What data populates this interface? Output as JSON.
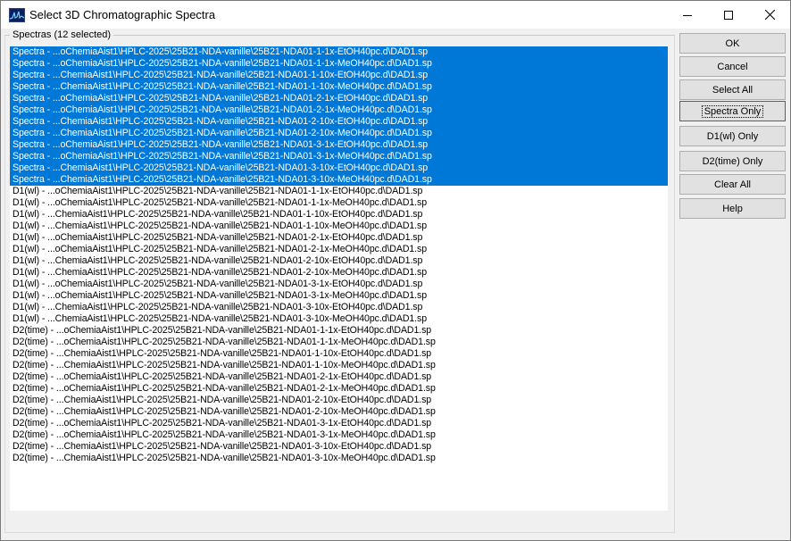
{
  "window": {
    "title": "Select 3D Chromatographic Spectra",
    "icon": "chromatogram-app-icon",
    "controls": [
      "minimize-icon",
      "maximize-icon",
      "close-icon"
    ]
  },
  "group": {
    "label": "Spectras (12 selected)"
  },
  "list": {
    "items": [
      {
        "text": "Spectra - ...oChemiaAist1\\HPLC-2025\\25B21-NDA-vanille\\25B21-NDA01-1-1x-EtOH40pc.d\\DAD1.sp",
        "selected": true
      },
      {
        "text": "Spectra - ...oChemiaAist1\\HPLC-2025\\25B21-NDA-vanille\\25B21-NDA01-1-1x-MeOH40pc.d\\DAD1.sp",
        "selected": true
      },
      {
        "text": "Spectra - ...ChemiaAist1\\HPLC-2025\\25B21-NDA-vanille\\25B21-NDA01-1-10x-EtOH40pc.d\\DAD1.sp",
        "selected": true
      },
      {
        "text": "Spectra - ...ChemiaAist1\\HPLC-2025\\25B21-NDA-vanille\\25B21-NDA01-1-10x-MeOH40pc.d\\DAD1.sp",
        "selected": true
      },
      {
        "text": "Spectra - ...oChemiaAist1\\HPLC-2025\\25B21-NDA-vanille\\25B21-NDA01-2-1x-EtOH40pc.d\\DAD1.sp",
        "selected": true
      },
      {
        "text": "Spectra - ...oChemiaAist1\\HPLC-2025\\25B21-NDA-vanille\\25B21-NDA01-2-1x-MeOH40pc.d\\DAD1.sp",
        "selected": true
      },
      {
        "text": "Spectra - ...ChemiaAist1\\HPLC-2025\\25B21-NDA-vanille\\25B21-NDA01-2-10x-EtOH40pc.d\\DAD1.sp",
        "selected": true
      },
      {
        "text": "Spectra - ...ChemiaAist1\\HPLC-2025\\25B21-NDA-vanille\\25B21-NDA01-2-10x-MeOH40pc.d\\DAD1.sp",
        "selected": true
      },
      {
        "text": "Spectra - ...oChemiaAist1\\HPLC-2025\\25B21-NDA-vanille\\25B21-NDA01-3-1x-EtOH40pc.d\\DAD1.sp",
        "selected": true
      },
      {
        "text": "Spectra - ...oChemiaAist1\\HPLC-2025\\25B21-NDA-vanille\\25B21-NDA01-3-1x-MeOH40pc.d\\DAD1.sp",
        "selected": true
      },
      {
        "text": "Spectra - ...ChemiaAist1\\HPLC-2025\\25B21-NDA-vanille\\25B21-NDA01-3-10x-EtOH40pc.d\\DAD1.sp",
        "selected": true
      },
      {
        "text": "Spectra - ...ChemiaAist1\\HPLC-2025\\25B21-NDA-vanille\\25B21-NDA01-3-10x-MeOH40pc.d\\DAD1.sp",
        "selected": true
      },
      {
        "text": "D1(wl) - ...oChemiaAist1\\HPLC-2025\\25B21-NDA-vanille\\25B21-NDA01-1-1x-EtOH40pc.d\\DAD1.sp",
        "selected": false
      },
      {
        "text": "D1(wl) - ...oChemiaAist1\\HPLC-2025\\25B21-NDA-vanille\\25B21-NDA01-1-1x-MeOH40pc.d\\DAD1.sp",
        "selected": false
      },
      {
        "text": "D1(wl) - ...ChemiaAist1\\HPLC-2025\\25B21-NDA-vanille\\25B21-NDA01-1-10x-EtOH40pc.d\\DAD1.sp",
        "selected": false
      },
      {
        "text": "D1(wl) - ...ChemiaAist1\\HPLC-2025\\25B21-NDA-vanille\\25B21-NDA01-1-10x-MeOH40pc.d\\DAD1.sp",
        "selected": false
      },
      {
        "text": "D1(wl) - ...oChemiaAist1\\HPLC-2025\\25B21-NDA-vanille\\25B21-NDA01-2-1x-EtOH40pc.d\\DAD1.sp",
        "selected": false
      },
      {
        "text": "D1(wl) - ...oChemiaAist1\\HPLC-2025\\25B21-NDA-vanille\\25B21-NDA01-2-1x-MeOH40pc.d\\DAD1.sp",
        "selected": false
      },
      {
        "text": "D1(wl) - ...ChemiaAist1\\HPLC-2025\\25B21-NDA-vanille\\25B21-NDA01-2-10x-EtOH40pc.d\\DAD1.sp",
        "selected": false
      },
      {
        "text": "D1(wl) - ...ChemiaAist1\\HPLC-2025\\25B21-NDA-vanille\\25B21-NDA01-2-10x-MeOH40pc.d\\DAD1.sp",
        "selected": false
      },
      {
        "text": "D1(wl) - ...oChemiaAist1\\HPLC-2025\\25B21-NDA-vanille\\25B21-NDA01-3-1x-EtOH40pc.d\\DAD1.sp",
        "selected": false
      },
      {
        "text": "D1(wl) - ...oChemiaAist1\\HPLC-2025\\25B21-NDA-vanille\\25B21-NDA01-3-1x-MeOH40pc.d\\DAD1.sp",
        "selected": false
      },
      {
        "text": "D1(wl) - ...ChemiaAist1\\HPLC-2025\\25B21-NDA-vanille\\25B21-NDA01-3-10x-EtOH40pc.d\\DAD1.sp",
        "selected": false
      },
      {
        "text": "D1(wl) - ...ChemiaAist1\\HPLC-2025\\25B21-NDA-vanille\\25B21-NDA01-3-10x-MeOH40pc.d\\DAD1.sp",
        "selected": false
      },
      {
        "text": "D2(time) - ...oChemiaAist1\\HPLC-2025\\25B21-NDA-vanille\\25B21-NDA01-1-1x-EtOH40pc.d\\DAD1.sp",
        "selected": false
      },
      {
        "text": "D2(time) - ...oChemiaAist1\\HPLC-2025\\25B21-NDA-vanille\\25B21-NDA01-1-1x-MeOH40pc.d\\DAD1.sp",
        "selected": false
      },
      {
        "text": "D2(time) - ...ChemiaAist1\\HPLC-2025\\25B21-NDA-vanille\\25B21-NDA01-1-10x-EtOH40pc.d\\DAD1.sp",
        "selected": false
      },
      {
        "text": "D2(time) - ...ChemiaAist1\\HPLC-2025\\25B21-NDA-vanille\\25B21-NDA01-1-10x-MeOH40pc.d\\DAD1.sp",
        "selected": false
      },
      {
        "text": "D2(time) - ...oChemiaAist1\\HPLC-2025\\25B21-NDA-vanille\\25B21-NDA01-2-1x-EtOH40pc.d\\DAD1.sp",
        "selected": false
      },
      {
        "text": "D2(time) - ...oChemiaAist1\\HPLC-2025\\25B21-NDA-vanille\\25B21-NDA01-2-1x-MeOH40pc.d\\DAD1.sp",
        "selected": false
      },
      {
        "text": "D2(time) - ...ChemiaAist1\\HPLC-2025\\25B21-NDA-vanille\\25B21-NDA01-2-10x-EtOH40pc.d\\DAD1.sp",
        "selected": false
      },
      {
        "text": "D2(time) - ...ChemiaAist1\\HPLC-2025\\25B21-NDA-vanille\\25B21-NDA01-2-10x-MeOH40pc.d\\DAD1.sp",
        "selected": false
      },
      {
        "text": "D2(time) - ...oChemiaAist1\\HPLC-2025\\25B21-NDA-vanille\\25B21-NDA01-3-1x-EtOH40pc.d\\DAD1.sp",
        "selected": false
      },
      {
        "text": "D2(time) - ...oChemiaAist1\\HPLC-2025\\25B21-NDA-vanille\\25B21-NDA01-3-1x-MeOH40pc.d\\DAD1.sp",
        "selected": false
      },
      {
        "text": "D2(time) - ...ChemiaAist1\\HPLC-2025\\25B21-NDA-vanille\\25B21-NDA01-3-10x-EtOH40pc.d\\DAD1.sp",
        "selected": false
      },
      {
        "text": "D2(time) - ...ChemiaAist1\\HPLC-2025\\25B21-NDA-vanille\\25B21-NDA01-3-10x-MeOH40pc.d\\DAD1.sp",
        "selected": false
      }
    ]
  },
  "buttons": {
    "ok": "OK",
    "cancel": "Cancel",
    "select_all": "Select All",
    "spectra_only": "Spectra Only",
    "d1_only": "D1(wl) Only",
    "d2_only": "D2(time) Only",
    "clear_all": "Clear All",
    "help": "Help"
  },
  "colors": {
    "selection": "#0078d7",
    "selection_text": "#ffffff",
    "dialog_bg": "#f0f0f0",
    "button_bg": "#e1e1e1",
    "button_border": "#adadad"
  }
}
